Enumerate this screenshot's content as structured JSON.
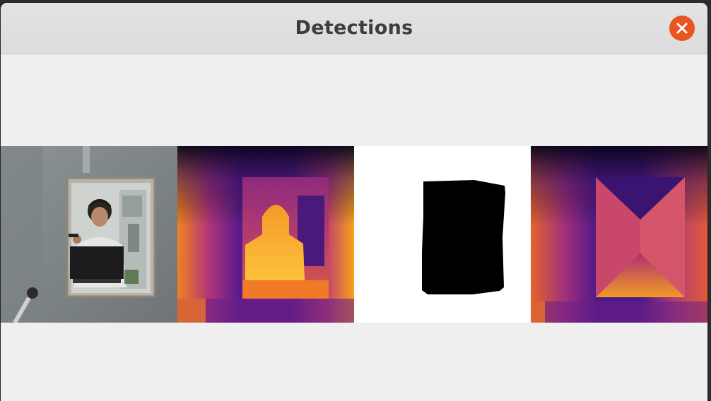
{
  "window": {
    "title": "Detections",
    "close_icon": "close-icon",
    "accent_color": "#e95420"
  },
  "panels": [
    {
      "name": "camera-rgb-image",
      "kind": "photo"
    },
    {
      "name": "depth-map-image",
      "kind": "depth-colormap"
    },
    {
      "name": "segmentation-mask-image",
      "kind": "binary-mask"
    },
    {
      "name": "depth-estimate-image",
      "kind": "depth-colormap"
    }
  ],
  "colors": {
    "background": "#efefef",
    "titlebar": "#dedede",
    "mask_black": "#000000",
    "mask_white": "#ffffff"
  }
}
